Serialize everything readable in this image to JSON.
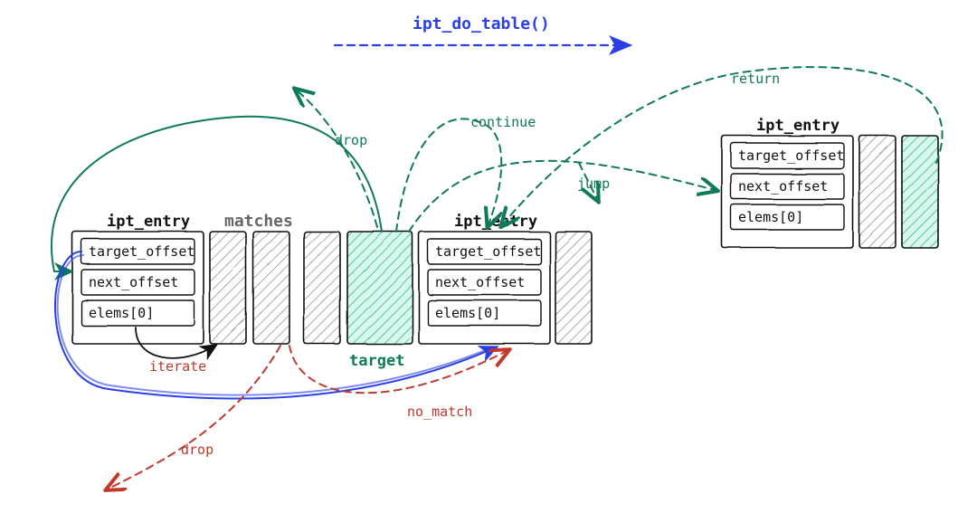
{
  "title": "ipt_do_table()",
  "entry_labels": {
    "left": "ipt_entry",
    "middle": "ipt_entry",
    "right": "ipt_entry"
  },
  "section_labels": {
    "matches": "matches",
    "target": "target"
  },
  "fields": {
    "target_offset": "target_offset",
    "next_offset": "next_offset",
    "elems": "elems[0]"
  },
  "flows": {
    "drop_green": "drop",
    "continue": "continue",
    "jump": "jump",
    "return": "return",
    "iterate": "iterate",
    "no_match": "no_match",
    "drop_red": "drop"
  },
  "colors": {
    "blue": "#2a3fe6",
    "green": "#0f7a5a",
    "red": "#c0392b",
    "gray": "#666666",
    "black": "#111111",
    "greenFill": "#6ee7c5"
  }
}
